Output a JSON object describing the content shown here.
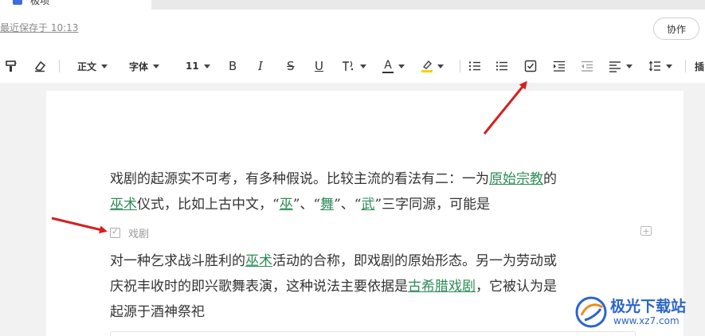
{
  "tab": {
    "title": "极项"
  },
  "header": {
    "last_saved": "最近保存于 10:13",
    "collab_label": "协作"
  },
  "toolbar": {
    "style_label": "正文",
    "font_label": "字体",
    "size_label": "11",
    "bold": "B",
    "italic": "I",
    "strike": "S",
    "underline": "U",
    "text_color": "A",
    "insert_label": "插"
  },
  "document": {
    "para1_line1": [
      {
        "text": "戏剧的起源实不可考，有多种假说。比较主流的看法有二：一为",
        "link": false
      },
      {
        "text": "原始宗教",
        "link": true
      },
      {
        "text": "的",
        "link": false
      }
    ],
    "para1_line2": [
      {
        "text": "巫术",
        "link": true
      },
      {
        "text": "仪式，比如上古中文，“",
        "link": false
      },
      {
        "text": "巫",
        "link": true
      },
      {
        "text": "”、“",
        "link": false
      },
      {
        "text": "舞",
        "link": true
      },
      {
        "text": "”、“",
        "link": false
      },
      {
        "text": "武",
        "link": true
      },
      {
        "text": "”三字同源，可能是",
        "link": false
      }
    ],
    "task_text": "戏剧",
    "para2_line1": [
      {
        "text": "对一种乞求战斗胜利的",
        "link": false
      },
      {
        "text": "巫术",
        "link": true
      },
      {
        "text": "活动的合称，即戏剧的原始形态。另一为劳动或",
        "link": false
      }
    ],
    "para2_line2": [
      {
        "text": "庆祝丰收时的即兴歌舞表演，这种说法主要依据是",
        "link": false
      },
      {
        "text": "古希腊戏剧",
        "link": true
      },
      {
        "text": "，它被认为是",
        "link": false
      }
    ],
    "para2_line3": [
      {
        "text": "起源于酒神祭祀",
        "link": false
      }
    ]
  },
  "watermark": {
    "name": "极光下载站",
    "url": "www.xz7.com"
  },
  "colors": {
    "link": "#2e8b57",
    "arrow": "#d42020",
    "accent": "#2b66c7"
  }
}
